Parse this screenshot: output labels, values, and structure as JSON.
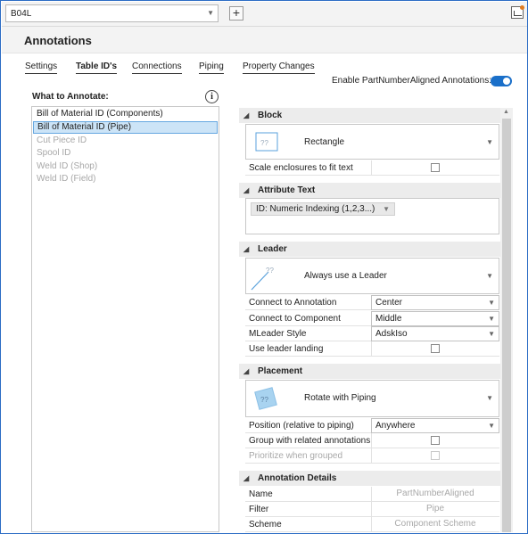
{
  "top": {
    "combo_value": "B04L",
    "combo_arrow_icon": "chevron-down-icon",
    "plus_label": "+"
  },
  "header": {
    "title": "Annotations"
  },
  "tabs": [
    {
      "label": "Settings",
      "active": false
    },
    {
      "label": "Table ID's",
      "active": true
    },
    {
      "label": "Connections",
      "active": false
    },
    {
      "label": "Piping",
      "active": false
    },
    {
      "label": "Property Changes",
      "active": false
    }
  ],
  "enable": {
    "label": "Enable PartNumberAligned Annotations:",
    "on": true
  },
  "what_to_annotate": {
    "label": "What to Annotate:",
    "info_glyph": "i",
    "items": [
      {
        "label": "Bill of Material ID (Components)",
        "state": "normal"
      },
      {
        "label": "Bill of Material ID (Pipe)",
        "state": "selected"
      },
      {
        "label": "Cut Piece ID",
        "state": "disabled"
      },
      {
        "label": "Spool ID",
        "state": "disabled"
      },
      {
        "label": "Weld ID (Shop)",
        "state": "disabled"
      },
      {
        "label": "Weld ID (Field)",
        "state": "disabled"
      }
    ]
  },
  "block": {
    "title": "Block",
    "preview_label": "Rectangle",
    "preview_glyph": "??",
    "scale_label": "Scale enclosures to fit text"
  },
  "attribute_text": {
    "title": "Attribute Text",
    "chip_value": "ID: Numeric Indexing (1,2,3...)"
  },
  "leader": {
    "title": "Leader",
    "preview_label": "Always use a Leader",
    "preview_glyph": "??",
    "connect_annotation_label": "Connect to Annotation",
    "connect_annotation_value": "Center",
    "connect_component_label": "Connect to Component",
    "connect_component_value": "Middle",
    "mleader_label": "MLeader Style",
    "mleader_value": "AdskIso",
    "landing_label": "Use leader landing"
  },
  "placement": {
    "title": "Placement",
    "preview_label": "Rotate with Piping",
    "preview_glyph": "??",
    "position_label": "Position (relative to piping)",
    "position_value": "Anywhere",
    "group_label": "Group with related annotations",
    "prioritize_label": "Prioritize when grouped"
  },
  "details": {
    "title": "Annotation Details",
    "name_label": "Name",
    "name_value": "PartNumberAligned",
    "filter_label": "Filter",
    "filter_value": "Pipe",
    "scheme_label": "Scheme",
    "scheme_value": "Component Scheme"
  },
  "colors": {
    "accent": "#1a6fc9",
    "selected_bg": "#cce4f7",
    "disabled_text": "#a8a8a8"
  }
}
